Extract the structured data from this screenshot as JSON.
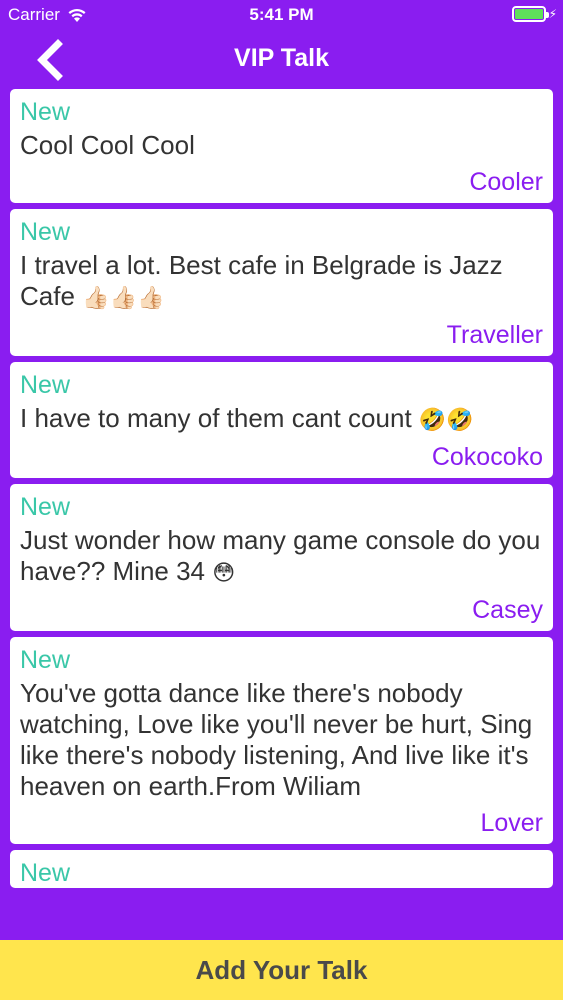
{
  "status_bar": {
    "carrier": "Carrier",
    "time": "5:41 PM",
    "battery_color": "#5fe05a"
  },
  "nav": {
    "title": "VIP Talk",
    "back_icon": "chevron-left-icon"
  },
  "theme": {
    "primary": "#8a1df0",
    "new_tag": "#3ac7a8",
    "button_bg": "#ffe54d"
  },
  "talks": [
    {
      "tag": "New",
      "message": "Cool Cool Cool",
      "emoji": "",
      "author": "Cooler"
    },
    {
      "tag": "New",
      "message": "I travel a lot. Best cafe in Belgrade is Jazz Cafe",
      "emoji": "👍🏻👍🏻👍🏻",
      "author": "Traveller"
    },
    {
      "tag": "New",
      "message": "I have to many of them cant count",
      "emoji": "🤣🤣",
      "author": "Cokocoko"
    },
    {
      "tag": "New",
      "message": "Just wonder how many game console do you have?? Mine 34",
      "emoji": "😳",
      "author": "Casey"
    },
    {
      "tag": "New",
      "message": "You've gotta dance like there's nobody watching, Love like you'll never be hurt, Sing like there's nobody listening, And live like it's heaven on earth.From Wiliam",
      "emoji": "",
      "author": "Lover"
    },
    {
      "tag": "New",
      "message": "",
      "emoji": "",
      "author": ""
    }
  ],
  "footer": {
    "add_label": "Add Your Talk"
  }
}
